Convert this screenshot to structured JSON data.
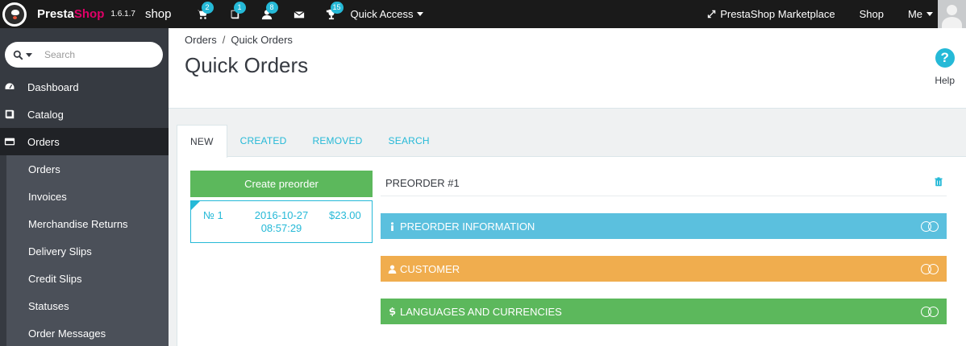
{
  "header": {
    "brand_presta": "Presta",
    "brand_shop": "Shop",
    "version": "1.6.1.7",
    "shop_name": "shop",
    "icons": [
      {
        "name": "cart-icon",
        "badge": "2"
      },
      {
        "name": "book-icon",
        "badge": "1"
      },
      {
        "name": "user-icon",
        "badge": "8"
      },
      {
        "name": "envelope-icon",
        "badge": ""
      },
      {
        "name": "trophy-icon",
        "badge": "15"
      }
    ],
    "quick_access": "Quick Access",
    "marketplace": "PrestaShop Marketplace",
    "shop_link": "Shop",
    "me": "Me"
  },
  "sidebar": {
    "search_placeholder": "Search",
    "items": [
      {
        "label": "Dashboard",
        "icon": "dashboard-icon"
      },
      {
        "label": "Catalog",
        "icon": "book-icon"
      },
      {
        "label": "Orders",
        "icon": "credit-card-icon"
      }
    ],
    "sub_items": [
      "Orders",
      "Invoices",
      "Merchandise Returns",
      "Delivery Slips",
      "Credit Slips",
      "Statuses",
      "Order Messages"
    ]
  },
  "page": {
    "breadcrumb": [
      "Orders",
      "Quick Orders"
    ],
    "title": "Quick Orders",
    "help": "Help"
  },
  "tabs": [
    "NEW",
    "CREATED",
    "REMOVED",
    "SEARCH"
  ],
  "create_button": "Create preorder",
  "order_card": {
    "number": "№ 1",
    "date": "2016-10-27",
    "time": "08:57:29",
    "amount": "$23.00"
  },
  "preorder": {
    "title": "PREORDER #1",
    "sections": [
      {
        "label": "PREORDER INFORMATION",
        "color": "#5bc0de",
        "icon": "info-icon"
      },
      {
        "label": "CUSTOMER",
        "color": "#f0ad4e",
        "icon": "user-icon"
      },
      {
        "label": "LANGUAGES AND CURRENCIES",
        "color": "#5cb85c",
        "icon": "dollar-icon"
      }
    ]
  },
  "colors": {
    "accent": "#25b9d7",
    "sidebar": "#363a41",
    "topbar": "#1a1a1a",
    "brand_pink": "#df0067"
  }
}
